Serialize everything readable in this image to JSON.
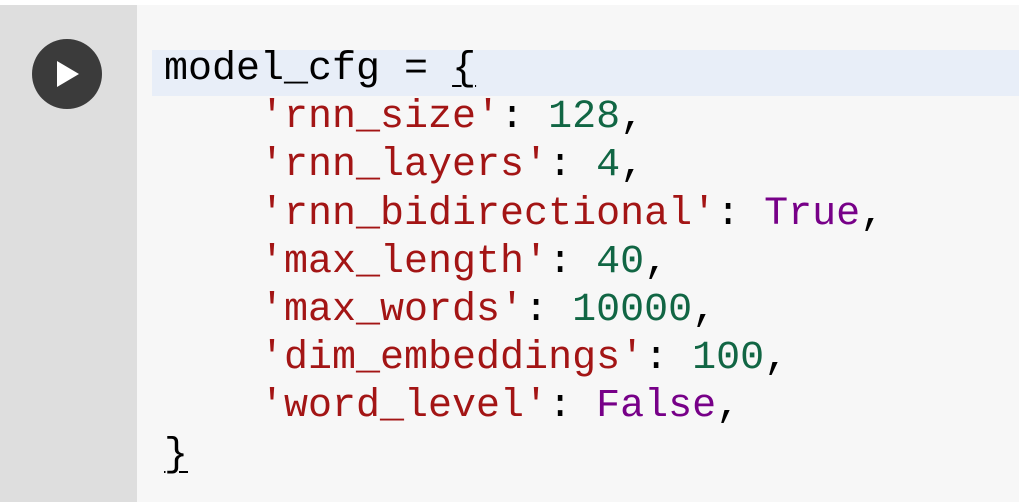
{
  "cell": {
    "run_button": {
      "icon": "play-icon",
      "icon_color": "#ffffff",
      "bg_color": "#3b3b3b"
    },
    "code": {
      "line1": {
        "variable": "model_cfg",
        "operator": " = ",
        "open_brace": "{"
      },
      "entries": [
        {
          "key": "'rnn_size'",
          "sep": ": ",
          "value": "128",
          "value_type": "number",
          "trail": ","
        },
        {
          "key": "'rnn_layers'",
          "sep": ": ",
          "value": "4",
          "value_type": "number",
          "trail": ","
        },
        {
          "key": "'rnn_bidirectional'",
          "sep": ": ",
          "value": "True",
          "value_type": "keyword",
          "trail": ","
        },
        {
          "key": "'max_length'",
          "sep": ": ",
          "value": "40",
          "value_type": "number",
          "trail": ","
        },
        {
          "key": "'max_words'",
          "sep": ": ",
          "value": "10000",
          "value_type": "number",
          "trail": ","
        },
        {
          "key": "'dim_embeddings'",
          "sep": ": ",
          "value": "100",
          "value_type": "number",
          "trail": ","
        },
        {
          "key": "'word_level'",
          "sep": ": ",
          "value": "False",
          "value_type": "keyword",
          "trail": ","
        }
      ],
      "close_brace": "}",
      "indent": "    "
    }
  },
  "colors": {
    "string": "#a31515",
    "number": "#116644",
    "keyword": "#770088",
    "active_line": "#e8eef8",
    "gutter": "#dedede",
    "cell_bg": "#f7f7f7"
  }
}
